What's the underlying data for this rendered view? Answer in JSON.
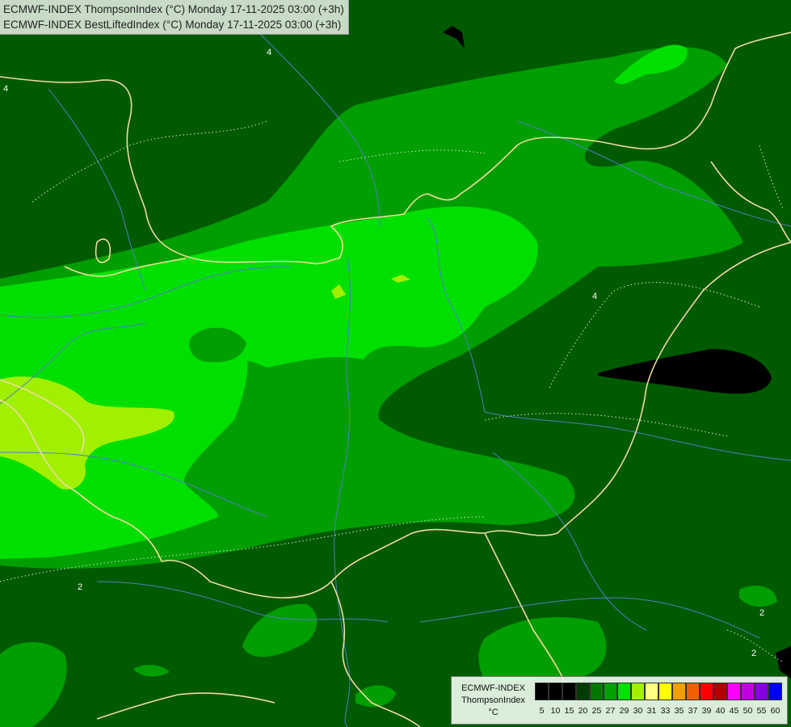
{
  "title": {
    "line1": "ECMWF-INDEX ThompsonIndex (°C) Monday 17-11-2025 03:00 (+3h)",
    "line2": "ECMWF-INDEX BestLiftedIndex (°C) Monday 17-11-2025 03:00 (+3h)"
  },
  "legend": {
    "model": "ECMWF-INDEX",
    "parameter": "ThompsonIndex",
    "unit": "°C",
    "ticks": [
      "5",
      "10",
      "15",
      "20",
      "25",
      "27",
      "29",
      "30",
      "31",
      "33",
      "35",
      "37",
      "39",
      "40",
      "45",
      "50",
      "55",
      "60"
    ],
    "colors": [
      "#000000",
      "#000000",
      "#000000",
      "#003c00",
      "#007800",
      "#00a000",
      "#00e000",
      "#a0f000",
      "#ffff80",
      "#ffff00",
      "#f0a000",
      "#f06000",
      "#ff0000",
      "#b00000",
      "#ff00ff",
      "#c000e0",
      "#8000e0",
      "#0000ff"
    ]
  },
  "contour_labels": [
    "4",
    "4",
    "2",
    "2",
    "2",
    "4"
  ],
  "colors": {
    "dark_green": "#005a00",
    "mid_green": "#009e00",
    "bright_green": "#00e000",
    "yellow_green": "#a0f000",
    "black_cell": "#000000",
    "border": "#f0dca0",
    "river": "#4f7fbf"
  }
}
